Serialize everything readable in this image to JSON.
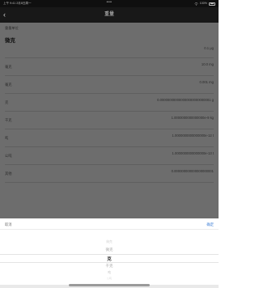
{
  "status_bar": {
    "time": "上午 9:41",
    "date": "2月8日周一",
    "center": "•••",
    "battery_text": "100%"
  },
  "navbar": {
    "title": "重量",
    "back_icon": "chevron-left-icon"
  },
  "content": {
    "header": {
      "label": "重量单位",
      "value": "微克"
    },
    "rows": [
      {
        "label": "",
        "value": "0.1 μg"
      },
      {
        "label": "毫克",
        "value": "10.0 mg"
      },
      {
        "label": "毫克",
        "value": "0.001 mg"
      },
      {
        "label": "克",
        "value": "0.000000000000000000000000001 g"
      },
      {
        "label": "千克",
        "value": "1.0000000000000000e-9 kg"
      },
      {
        "label": "吨",
        "value": "1.0000000000000000e-12 t"
      },
      {
        "label": "公吨",
        "value": "1.0000000000000000e-13 t"
      },
      {
        "label": "其他",
        "value": "0.000000000000000000001"
      }
    ]
  },
  "sheet": {
    "cancel": "取消",
    "confirm": "确定",
    "options": [
      "纳克",
      "微克",
      "克",
      "千克",
      "吨",
      "公吨"
    ],
    "selected": "克"
  }
}
